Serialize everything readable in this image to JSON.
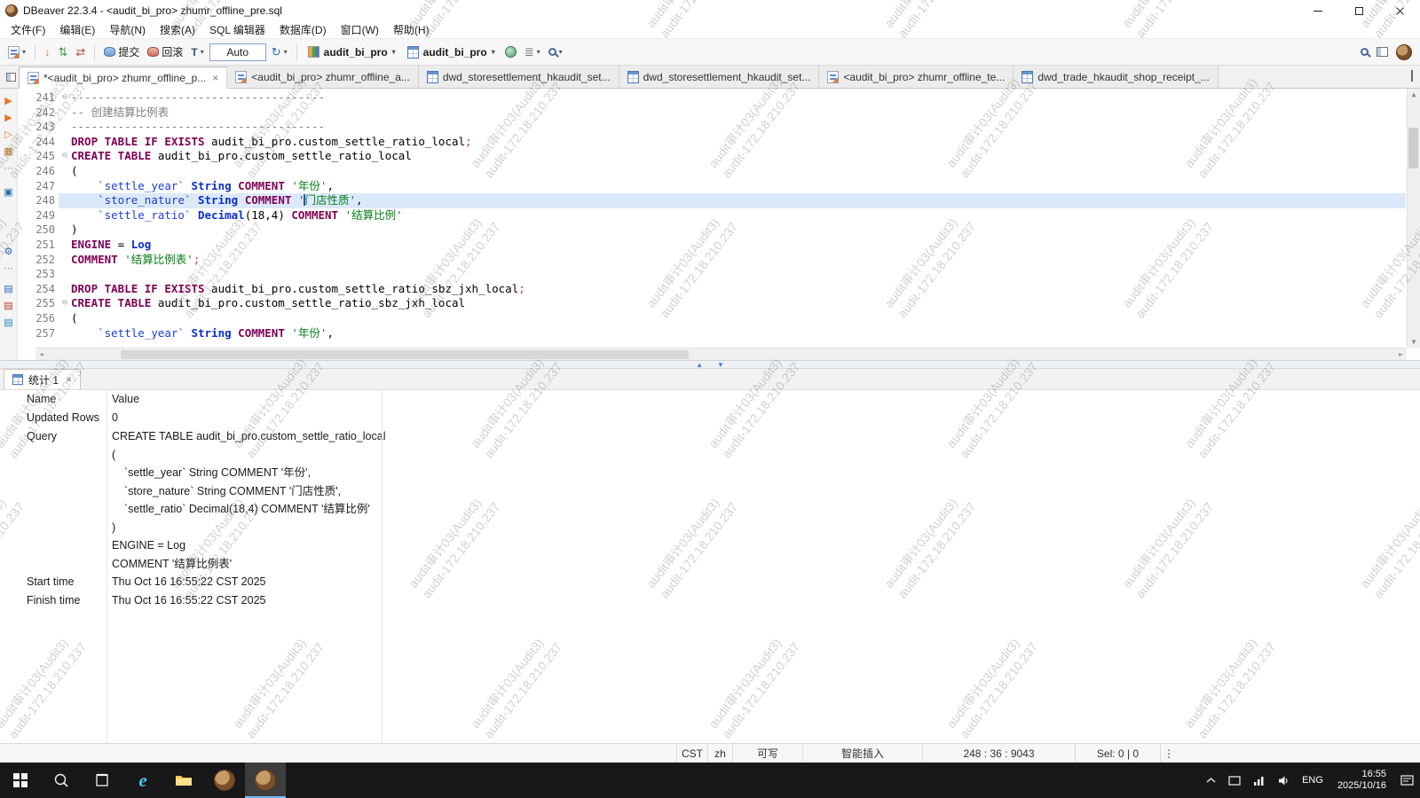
{
  "window": {
    "title": "DBeaver 22.3.4 - <audit_bi_pro> zhumr_offline_pre.sql"
  },
  "menu": {
    "items": [
      "文件(F)",
      "编辑(E)",
      "导航(N)",
      "搜索(A)",
      "SQL 编辑器",
      "数据库(D)",
      "窗口(W)",
      "帮助(H)"
    ]
  },
  "toolbar": {
    "commit": "提交",
    "rollback": "回滚",
    "txn": "T",
    "auto": "Auto",
    "database": "audit_bi_pro",
    "schema": "audit_bi_pro"
  },
  "tabs": [
    {
      "icon": "sql",
      "label": "*<audit_bi_pro> zhumr_offline_p...",
      "active": true,
      "closable": true
    },
    {
      "icon": "sql",
      "label": "<audit_bi_pro> zhumr_offline_a...",
      "active": false,
      "closable": false
    },
    {
      "icon": "table",
      "label": "dwd_storesettlement_hkaudit_set...",
      "active": false,
      "closable": false
    },
    {
      "icon": "table",
      "label": "dwd_storesettlement_hkaudit_set...",
      "active": false,
      "closable": false
    },
    {
      "icon": "sql",
      "label": "<audit_bi_pro> zhumr_offline_te...",
      "active": false,
      "closable": false
    },
    {
      "icon": "table",
      "label": "dwd_trade_hkaudit_shop_receipt_...",
      "active": false,
      "closable": false
    }
  ],
  "rail": [
    {
      "name": "execute-statement-icon",
      "glyph": "▶",
      "color": "#e8762d"
    },
    {
      "name": "execute-script-icon",
      "glyph": "▶",
      "color": "#e8762d"
    },
    {
      "name": "execute-new-tab-icon",
      "glyph": "▷",
      "color": "#e8762d"
    },
    {
      "name": "explain-plan-icon",
      "glyph": "▦",
      "color": "#c07b2a"
    },
    {
      "name": "rail-overflow-dots",
      "glyph": "⋯",
      "color": "#999999"
    },
    {
      "name": "sql-console-icon",
      "glyph": "▣",
      "color": "#2b6cb0",
      "gap": 8
    },
    {
      "name": "settings-icon",
      "glyph": "⚙",
      "color": "#2b6cb0",
      "gap": 48
    },
    {
      "name": "rail-overflow-dots-2",
      "glyph": "⋯",
      "color": "#999999"
    },
    {
      "name": "load-script-icon",
      "glyph": "▤",
      "color": "#2b6cb0",
      "gap": 4
    },
    {
      "name": "save-script-icon",
      "glyph": "▤",
      "color": "#c0392b"
    },
    {
      "name": "export-script-icon",
      "glyph": "▤",
      "color": "#2980b9"
    }
  ],
  "editor": {
    "lines": [
      {
        "no": 241,
        "fold": true,
        "tokens": [
          {
            "c": "c",
            "t": "--------------------------------------"
          }
        ]
      },
      {
        "no": 242,
        "tokens": [
          {
            "c": "c",
            "t": "-- 创建结算比例表"
          }
        ]
      },
      {
        "no": 243,
        "tokens": [
          {
            "c": "c",
            "t": "--------------------------------------"
          }
        ]
      },
      {
        "no": 244,
        "tokens": [
          {
            "c": "k",
            "t": "DROP TABLE IF EXISTS"
          },
          {
            "c": "n",
            "t": " audit_bi_pro.custom_settle_ratio_local"
          },
          {
            "c": "d",
            "t": ";"
          }
        ]
      },
      {
        "no": 245,
        "fold": true,
        "tokens": [
          {
            "c": "k",
            "t": "CREATE TABLE"
          },
          {
            "c": "n",
            "t": " audit_bi_pro.custom_settle_ratio_local"
          }
        ]
      },
      {
        "no": 246,
        "tokens": [
          {
            "c": "n",
            "t": "("
          }
        ]
      },
      {
        "no": 247,
        "tokens": [
          {
            "c": "n",
            "t": "    "
          },
          {
            "c": "i",
            "t": "`settle_year`"
          },
          {
            "c": "n",
            "t": " "
          },
          {
            "c": "t",
            "t": "String"
          },
          {
            "c": "n",
            "t": " "
          },
          {
            "c": "k",
            "t": "COMMENT"
          },
          {
            "c": "n",
            "t": " "
          },
          {
            "c": "s",
            "t": "'年份'"
          },
          {
            "c": "n",
            "t": ","
          }
        ]
      },
      {
        "no": 248,
        "current": true,
        "tokens": [
          {
            "c": "n",
            "t": "    "
          },
          {
            "c": "i",
            "t": "`store_nature`"
          },
          {
            "c": "n",
            "t": " "
          },
          {
            "c": "t",
            "t": "String"
          },
          {
            "c": "n",
            "t": " "
          },
          {
            "c": "k",
            "t": "COMMENT"
          },
          {
            "c": "n",
            "t": " "
          },
          {
            "c": "s",
            "t": "'"
          },
          {
            "c": "caret",
            "t": ""
          },
          {
            "c": "s",
            "t": "门店性质'"
          },
          {
            "c": "n",
            "t": ","
          }
        ]
      },
      {
        "no": 249,
        "tokens": [
          {
            "c": "n",
            "t": "    "
          },
          {
            "c": "i",
            "t": "`settle_ratio`"
          },
          {
            "c": "n",
            "t": " "
          },
          {
            "c": "t",
            "t": "Decimal"
          },
          {
            "c": "n",
            "t": "(18,4) "
          },
          {
            "c": "k",
            "t": "COMMENT"
          },
          {
            "c": "n",
            "t": " "
          },
          {
            "c": "s",
            "t": "'结算比例'"
          }
        ]
      },
      {
        "no": 250,
        "tokens": [
          {
            "c": "n",
            "t": ")"
          }
        ]
      },
      {
        "no": 251,
        "tokens": [
          {
            "c": "k",
            "t": "ENGINE"
          },
          {
            "c": "n",
            "t": " = "
          },
          {
            "c": "t",
            "t": "Log"
          }
        ]
      },
      {
        "no": 252,
        "tokens": [
          {
            "c": "k",
            "t": "COMMENT"
          },
          {
            "c": "n",
            "t": " "
          },
          {
            "c": "s",
            "t": "'结算比例表'"
          },
          {
            "c": "d",
            "t": ";"
          }
        ]
      },
      {
        "no": 253,
        "tokens": []
      },
      {
        "no": 254,
        "tokens": [
          {
            "c": "k",
            "t": "DROP TABLE IF EXISTS"
          },
          {
            "c": "n",
            "t": " audit_bi_pro.custom_settle_ratio_sbz_jxh_local"
          },
          {
            "c": "d",
            "t": ";"
          }
        ]
      },
      {
        "no": 255,
        "fold": true,
        "tokens": [
          {
            "c": "k",
            "t": "CREATE TABLE"
          },
          {
            "c": "n",
            "t": " audit_bi_pro.custom_settle_ratio_sbz_jxh_local"
          }
        ]
      },
      {
        "no": 256,
        "tokens": [
          {
            "c": "n",
            "t": "("
          }
        ]
      },
      {
        "no": 257,
        "tokens": [
          {
            "c": "n",
            "t": "    "
          },
          {
            "c": "i",
            "t": "`settle_year`"
          },
          {
            "c": "n",
            "t": " "
          },
          {
            "c": "t",
            "t": "String"
          },
          {
            "c": "n",
            "t": " "
          },
          {
            "c": "k",
            "t": "COMMENT"
          },
          {
            "c": "n",
            "t": " "
          },
          {
            "c": "s",
            "t": "'年份'"
          },
          {
            "c": "n",
            "t": ","
          }
        ]
      }
    ]
  },
  "panel": {
    "tab": "统计 1",
    "columns": [
      "Name",
      "Value"
    ],
    "rows": [
      {
        "name": "Updated Rows",
        "value": "0"
      },
      {
        "name": "Query",
        "value": "CREATE TABLE audit_bi_pro.custom_settle_ratio_local\n(\n    `settle_year` String COMMENT '年份',\n    `store_nature` String COMMENT '门店性质',\n    `settle_ratio` Decimal(18,4) COMMENT '结算比例'\n)\nENGINE = Log\nCOMMENT '结算比例表'"
      },
      {
        "name": "Start time",
        "value": "Thu Oct 16 16:55:22 CST 2025"
      },
      {
        "name": "Finish time",
        "value": "Thu Oct 16 16:55:22 CST 2025"
      }
    ]
  },
  "status": {
    "items": [
      "CST",
      "zh",
      "可写",
      "智能插入",
      "248 : 36 : 9043",
      "Sel: 0 | 0"
    ]
  },
  "taskbar": {
    "lang": "ENG",
    "time": "16:55",
    "date": "2025/10/16"
  },
  "watermark": {
    "line1": "audit审计03(Audit3)",
    "line2": "audit-172.18.210.237"
  },
  "icons": {
    "caret-down": "▾",
    "arrow-down": "↓",
    "arrows-updown": "⇅",
    "arrows-leftright": "⇄",
    "refresh": "↻",
    "branch": "≣",
    "fold": "⊖",
    "up": "▲",
    "down": "▼",
    "left": "◄",
    "right": "►",
    "close": "×",
    "overflow": "⋮"
  },
  "colors": {
    "kw": "#7F0055",
    "type": "#0a2ecc",
    "ident": "#1a3fd0",
    "str": "#067d17",
    "cm": "#7f7f7f",
    "delim": "#cc3333",
    "curline": "#dce9fb",
    "accent": "#3875d7"
  }
}
